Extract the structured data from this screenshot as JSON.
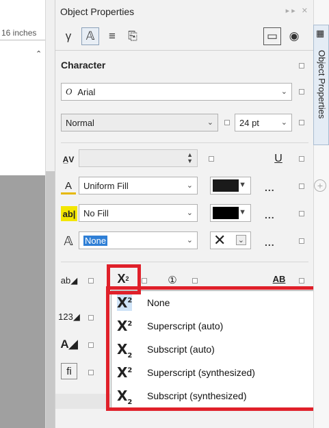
{
  "ruler": {
    "unit_text": "16 inches"
  },
  "panel": {
    "title": "Object Properties",
    "side_tab_label": "Object Properties",
    "section": "Character"
  },
  "font": {
    "family": "Arial",
    "style": "Normal",
    "size": "24 pt"
  },
  "fills": {
    "text_fill": "Uniform Fill",
    "text_fill_color": "#1a1a1a",
    "background_fill": "No Fill",
    "background_fill_color": "#000000",
    "outline": "None"
  },
  "more_label": "...",
  "position_menu": {
    "items": [
      {
        "label": "None",
        "glyph_sup": "2",
        "selected": true
      },
      {
        "label": "Superscript (auto)",
        "glyph_sup": "2"
      },
      {
        "label": "Subscript (auto)",
        "glyph_sub": "2"
      },
      {
        "label": "Superscript (synthesized)",
        "glyph_sup": "2"
      },
      {
        "label": "Subscript (synthesized)",
        "glyph_sub": "2"
      }
    ]
  },
  "highlight_color": "#e0202a"
}
